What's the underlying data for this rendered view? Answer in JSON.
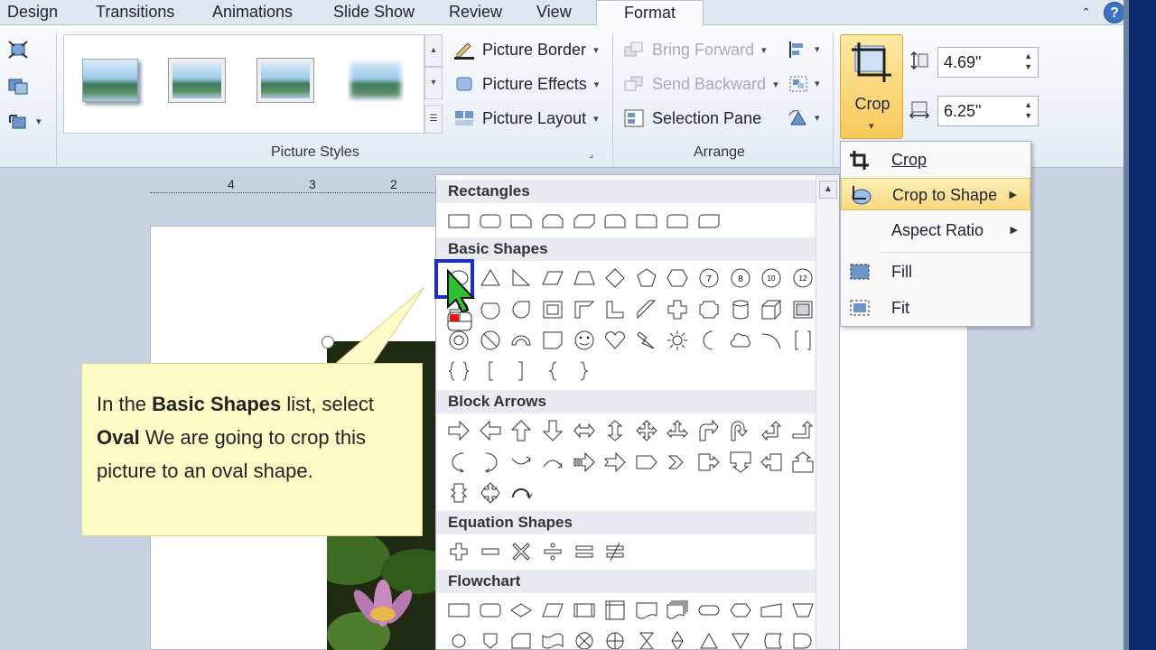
{
  "tabs": [
    "Design",
    "Transitions",
    "Animations",
    "Slide Show",
    "Review",
    "View",
    "Format"
  ],
  "ribbon": {
    "picture_border": "Picture Border",
    "picture_effects": "Picture Effects",
    "picture_layout": "Picture Layout",
    "picture_styles_label": "Picture Styles",
    "bring_forward": "Bring Forward",
    "send_backward": "Send Backward",
    "selection_pane": "Selection Pane",
    "arrange_label": "Arrange",
    "crop": "Crop",
    "height": "4.69\"",
    "width": "6.25\""
  },
  "ruler": [
    "4",
    "3",
    "2"
  ],
  "gallery": {
    "sections": {
      "rectangles": "Rectangles",
      "basic_shapes": "Basic Shapes",
      "block_arrows": "Block Arrows",
      "equation_shapes": "Equation Shapes",
      "flowchart": "Flowchart"
    },
    "selected_shape": "Oval"
  },
  "crop_menu": {
    "crop": "Crop",
    "crop_to_shape": "Crop to Shape",
    "aspect_ratio": "Aspect Ratio",
    "fill": "Fill",
    "fit": "Fit"
  },
  "callout": {
    "p1": "In the ",
    "b1": "Basic Shapes",
    "p2": " list, select ",
    "b2": "Oval",
    "p3": " We are going to crop this picture to an oval shape."
  },
  "colors": {
    "highlight": "#f9d87c",
    "selection": "#1b2bd8",
    "callout": "#fdfbc6"
  }
}
